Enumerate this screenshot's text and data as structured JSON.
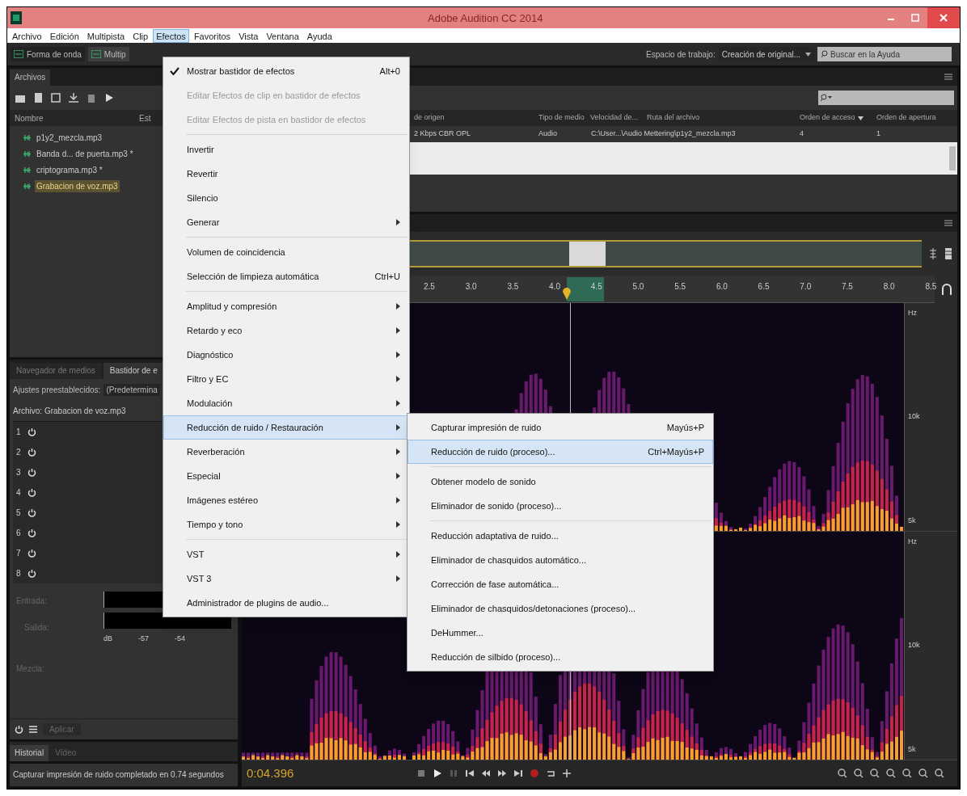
{
  "window": {
    "title": "Adobe Audition CC 2014"
  },
  "menu_bar": [
    {
      "label": "Archivo",
      "selected": false
    },
    {
      "label": "Edición",
      "selected": false
    },
    {
      "label": "Multipista",
      "selected": false
    },
    {
      "label": "Clip",
      "selected": false
    },
    {
      "label": "Efectos",
      "selected": true
    },
    {
      "label": "Favoritos",
      "selected": false
    },
    {
      "label": "Vista",
      "selected": false
    },
    {
      "label": "Ventana",
      "selected": false
    },
    {
      "label": "Ayuda",
      "selected": false
    }
  ],
  "toolbar": {
    "views": [
      {
        "label": "Forma de onda",
        "selected": false
      },
      {
        "label": "Multip",
        "selected": true
      }
    ],
    "workspace_label": "Espacio de trabajo:",
    "workspace_value": "Creación de original...",
    "help_search": {
      "placeholder": "Buscar en la Ayuda"
    }
  },
  "files_panel": {
    "tab": "Archivos",
    "columns_left": [
      "Nombre",
      "Est"
    ],
    "columns_right": [
      "de origen",
      "Tipo de medio",
      "Velocidad de...",
      "Ruta del archivo",
      "Orden de acceso",
      "Orden de apertura"
    ],
    "rows": [
      {
        "name": "p1y2_mezcla.mp3",
        "selected": false,
        "details": [
          "2 Kbps CBR OPL",
          "Audio",
          "C:\\User...\\Audio Mettering\\p1y2_mezcla.mp3",
          "4",
          "1"
        ]
      },
      {
        "name": "Banda d... de puerta.mp3 *",
        "selected": false
      },
      {
        "name": "criptograma.mp3 *",
        "selected": false
      },
      {
        "name": "Grabacion de voz.mp3",
        "selected": true
      }
    ]
  },
  "effects_rack": {
    "tabs": [
      {
        "label": "Navegador de medios",
        "selected": false
      },
      {
        "label": "Bastidor de e",
        "selected": true
      }
    ],
    "presets_label": "Ajustes preestablecidos:",
    "presets_value": "(Predetermina",
    "file": "Archivo: Grabacion de voz.mp3",
    "slots": [
      "1",
      "2",
      "3",
      "4",
      "5",
      "6",
      "7",
      "8"
    ],
    "input_label": "Entrada:",
    "output_label": "Salida:",
    "meter_ticks": [
      "dB",
      "-57",
      "-54"
    ],
    "mix_label": "Mezcla:",
    "apply": "Aplicar"
  },
  "history": {
    "tabs": [
      {
        "label": "Historial",
        "selected": true
      },
      {
        "label": "Vídeo",
        "selected": false
      }
    ]
  },
  "status_bar": "Capturar impresión de ruido completado en 0.74 segundos",
  "editor": {
    "ruler": [
      "2.5",
      "3.0",
      "3.5",
      "4.0",
      "4.5",
      "5.0",
      "5.5",
      "6.0",
      "6.5",
      "7.0",
      "7.5",
      "8.0",
      "8.5"
    ],
    "channels": [
      {
        "axis": [
          "Hz",
          "10k",
          "5k"
        ]
      },
      {
        "axis": [
          "Hz",
          "10k",
          "5k"
        ]
      }
    ],
    "time": "0:04.396"
  },
  "effects_menu": [
    {
      "kind": "item",
      "label": "Mostrar bastidor de efectos",
      "shortcut": "Alt+0",
      "checked": true,
      "selected": false
    },
    {
      "kind": "disabled",
      "label": "Editar Efectos de clip en bastidor de efectos",
      "checked": false,
      "selected": false
    },
    {
      "kind": "disabled",
      "label": "Editar Efectos de pista en bastidor de efectos",
      "checked": false,
      "selected": false
    },
    {
      "kind": "separator"
    },
    {
      "kind": "item",
      "label": "Invertir",
      "checked": false,
      "selected": false
    },
    {
      "kind": "item",
      "label": "Revertir",
      "checked": false,
      "selected": false
    },
    {
      "kind": "item",
      "label": "Silencio",
      "checked": false,
      "selected": false
    },
    {
      "kind": "submenu",
      "label": "Generar",
      "checked": false,
      "selected": false
    },
    {
      "kind": "separator"
    },
    {
      "kind": "item",
      "label": "Volumen de coincidencia",
      "checked": false,
      "selected": false
    },
    {
      "kind": "item",
      "label": "Selección de limpieza automática",
      "shortcut": "Ctrl+U",
      "checked": false,
      "selected": false
    },
    {
      "kind": "separator"
    },
    {
      "kind": "submenu",
      "label": "Amplitud y compresión",
      "checked": false,
      "selected": false
    },
    {
      "kind": "submenu",
      "label": "Retardo y eco",
      "checked": false,
      "selected": false
    },
    {
      "kind": "submenu",
      "label": "Diagnóstico",
      "checked": false,
      "selected": false
    },
    {
      "kind": "submenu",
      "label": "Filtro y EC",
      "checked": false,
      "selected": false
    },
    {
      "kind": "submenu",
      "label": "Modulación",
      "checked": false,
      "selected": false
    },
    {
      "kind": "submenu",
      "label": "Reducción de ruido / Restauración",
      "checked": false,
      "selected": true
    },
    {
      "kind": "submenu",
      "label": "Reverberación",
      "checked": false,
      "selected": false
    },
    {
      "kind": "submenu",
      "label": "Especial",
      "checked": false,
      "selected": false
    },
    {
      "kind": "submenu",
      "label": "Imágenes estéreo",
      "checked": false,
      "selected": false
    },
    {
      "kind": "submenu",
      "label": "Tiempo y tono",
      "checked": false,
      "selected": false
    },
    {
      "kind": "separator"
    },
    {
      "kind": "submenu",
      "label": "VST",
      "checked": false,
      "selected": false
    },
    {
      "kind": "submenu",
      "label": "VST 3",
      "checked": false,
      "selected": false
    },
    {
      "kind": "item",
      "label": "Administrador de plugins de audio...",
      "checked": false,
      "selected": false
    }
  ],
  "noise_submenu": [
    {
      "kind": "item",
      "label": "Capturar impresión de ruido",
      "shortcut": "Mayús+P",
      "selected": false
    },
    {
      "kind": "item",
      "label": "Reducción de ruido (proceso)...",
      "shortcut": "Ctrl+Mayús+P",
      "selected": true
    },
    {
      "kind": "separator"
    },
    {
      "kind": "item",
      "label": "Obtener modelo de sonido",
      "selected": false
    },
    {
      "kind": "item",
      "label": "Eliminador de sonido (proceso)...",
      "selected": false
    },
    {
      "kind": "separator"
    },
    {
      "kind": "item",
      "label": "Reducción adaptativa de ruido...",
      "selected": false
    },
    {
      "kind": "item",
      "label": "Eliminador de chasquidos automático...",
      "selected": false
    },
    {
      "kind": "item",
      "label": "Corrección de fase automática...",
      "selected": false
    },
    {
      "kind": "item",
      "label": "Eliminador de chasquidos/detonaciones (proceso)...",
      "selected": false
    },
    {
      "kind": "item",
      "label": "DeHummer...",
      "selected": false
    },
    {
      "kind": "item",
      "label": "Reducción de silbido (proceso)...",
      "selected": false
    }
  ]
}
